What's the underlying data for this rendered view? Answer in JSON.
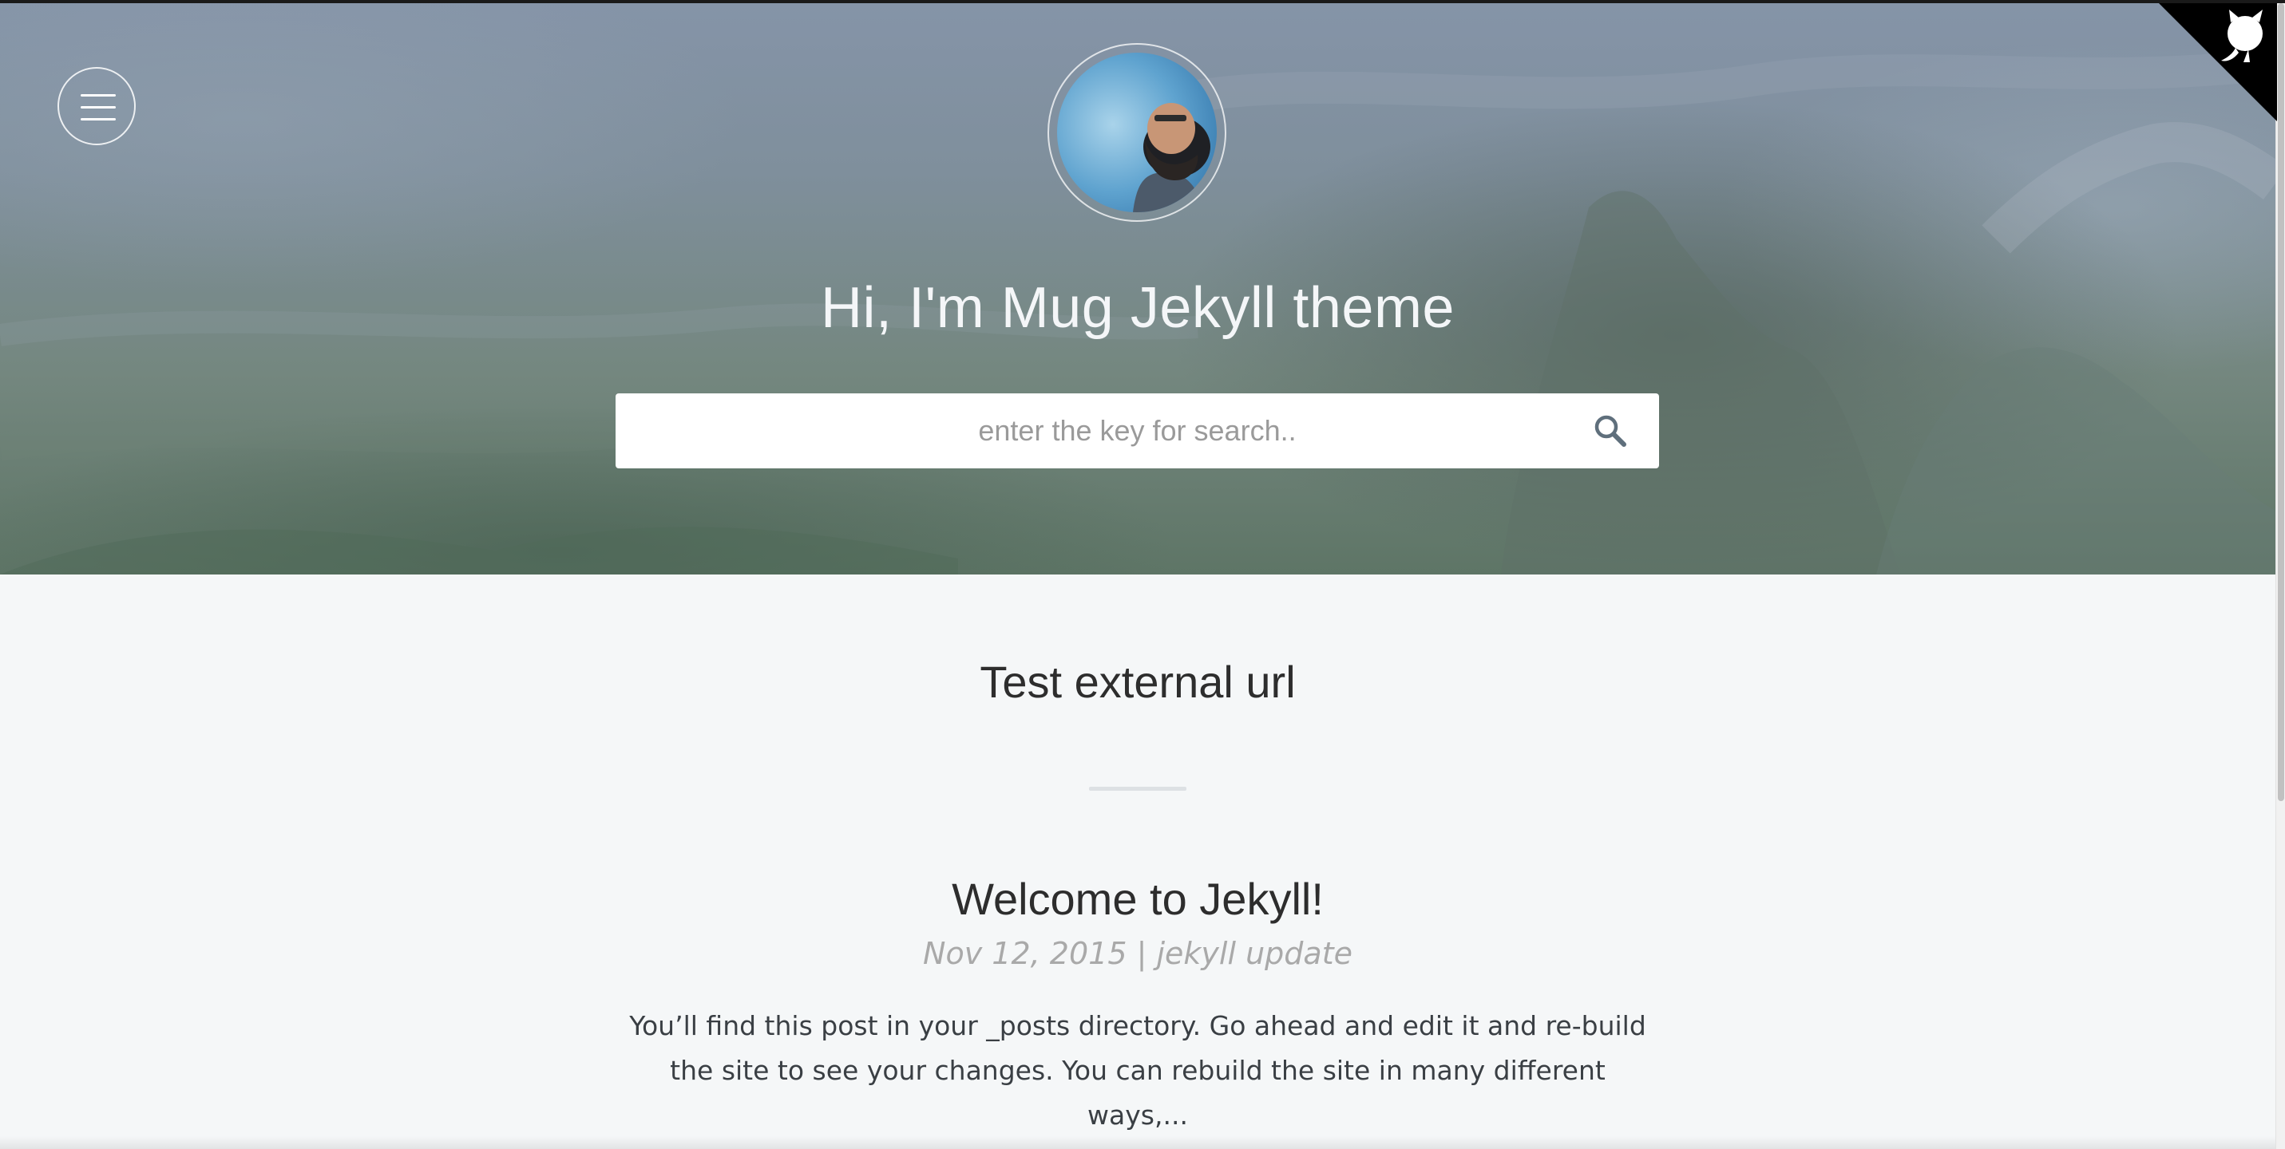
{
  "header": {
    "title": "Hi, I'm Mug Jekyll theme",
    "menu_icon": "hamburger-menu-icon",
    "avatar_icon": "avatar-photo",
    "corner_icon": "github-octocat-icon"
  },
  "search": {
    "placeholder": "enter the key for search..",
    "value": "",
    "icon": "search-icon"
  },
  "main": {
    "external_link": "Test external url",
    "posts": [
      {
        "title": "Welcome to Jekyll!",
        "meta": "Nov 12, 2015 | jekyll update",
        "excerpt": "You’ll find this post in your _posts directory. Go ahead and edit it and re-build the site to see your changes. You can rebuild the site in many different ways,..."
      }
    ]
  },
  "colors": {
    "hero_top": "#8594a8",
    "hero_bottom": "#5e7566",
    "page_background": "#f5f7f8",
    "text_dark": "#2d2d2d",
    "meta_gray": "#a9a9a9",
    "corner_black": "#000000"
  }
}
